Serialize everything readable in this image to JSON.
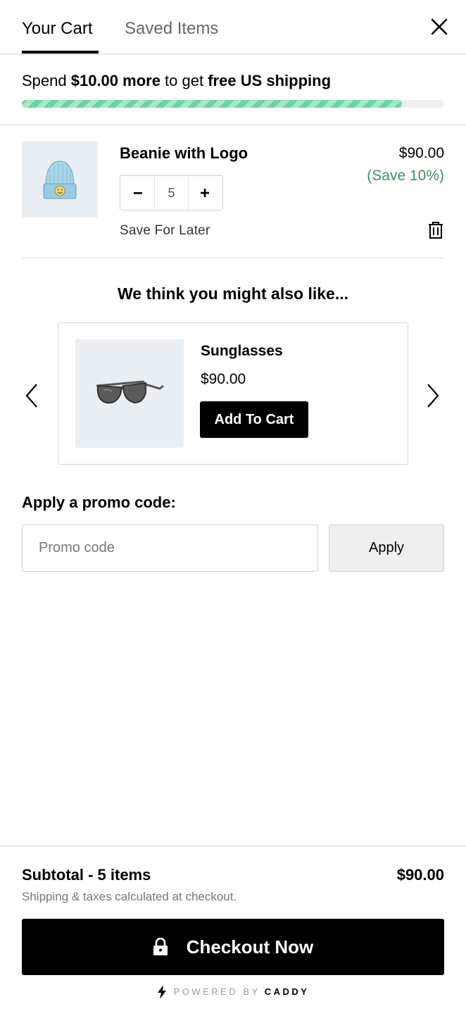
{
  "tabs": {
    "cart": "Your Cart",
    "saved": "Saved Items"
  },
  "icons": {
    "close": "close-icon",
    "minus": "minus-icon",
    "plus": "plus-icon",
    "trash": "trash-icon",
    "prev": "chevron-left-icon",
    "next": "chevron-right-icon",
    "lock": "lock-icon",
    "bolt": "bolt-icon"
  },
  "shipping": {
    "prefix": "Spend ",
    "amount": "$10.00 more",
    "middle": " to get ",
    "goal": "free US shipping",
    "progress_percent": 90,
    "bar_color": "#6bd3a0"
  },
  "cart_item": {
    "name": "Beanie with Logo",
    "quantity": "5",
    "price": "$90.00",
    "discount": "(Save 10%)",
    "save_for_later": "Save For Later",
    "image": "beanie-image"
  },
  "recommendations": {
    "title": "We think you might also like...",
    "item": {
      "name": "Sunglasses",
      "price": "$90.00",
      "button": "Add To Cart",
      "image": "sunglasses-image"
    }
  },
  "promo": {
    "label": "Apply a promo code:",
    "placeholder": "Promo code",
    "button": "Apply"
  },
  "footer": {
    "subtotal_label": "Subtotal - 5 items",
    "subtotal_value": "$90.00",
    "note": "Shipping & taxes calculated at checkout.",
    "checkout": "Checkout Now",
    "powered_by": "POWERED BY",
    "brand": "CADDY"
  },
  "colors": {
    "accent": "#000000",
    "discount": "#3e8e63",
    "progress": "#6bd3a0",
    "thumb_bg": "#e9eef2"
  }
}
